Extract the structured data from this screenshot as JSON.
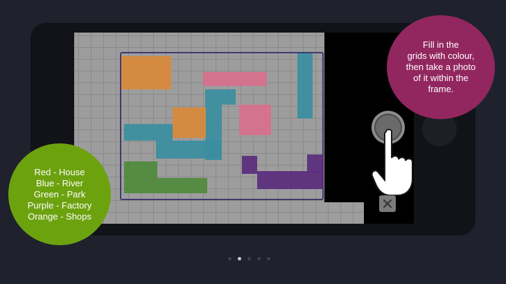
{
  "instruction": {
    "lines": [
      "Fill in the",
      "grids with colour,",
      "then take a photo",
      "of it within the",
      "frame."
    ]
  },
  "legend": {
    "lines": [
      "Red - House",
      "Blue - River",
      "Green - Park",
      "Purple - Factory",
      "Orange - Shops"
    ]
  },
  "icons": {
    "shutter": "camera-shutter-icon",
    "hand": "tap-hand-icon",
    "close": "close-icon"
  },
  "colors": {
    "instruction_bubble": "#92275f",
    "legend_bubble": "#6da20f",
    "background": "#1f222d",
    "red": "#d8708c",
    "blue": "#3a8ea0",
    "green": "#4f8a3c",
    "purple": "#5a2d7e",
    "orange": "#d98a3a"
  },
  "pagination": {
    "count": 5,
    "active_index": 1
  }
}
